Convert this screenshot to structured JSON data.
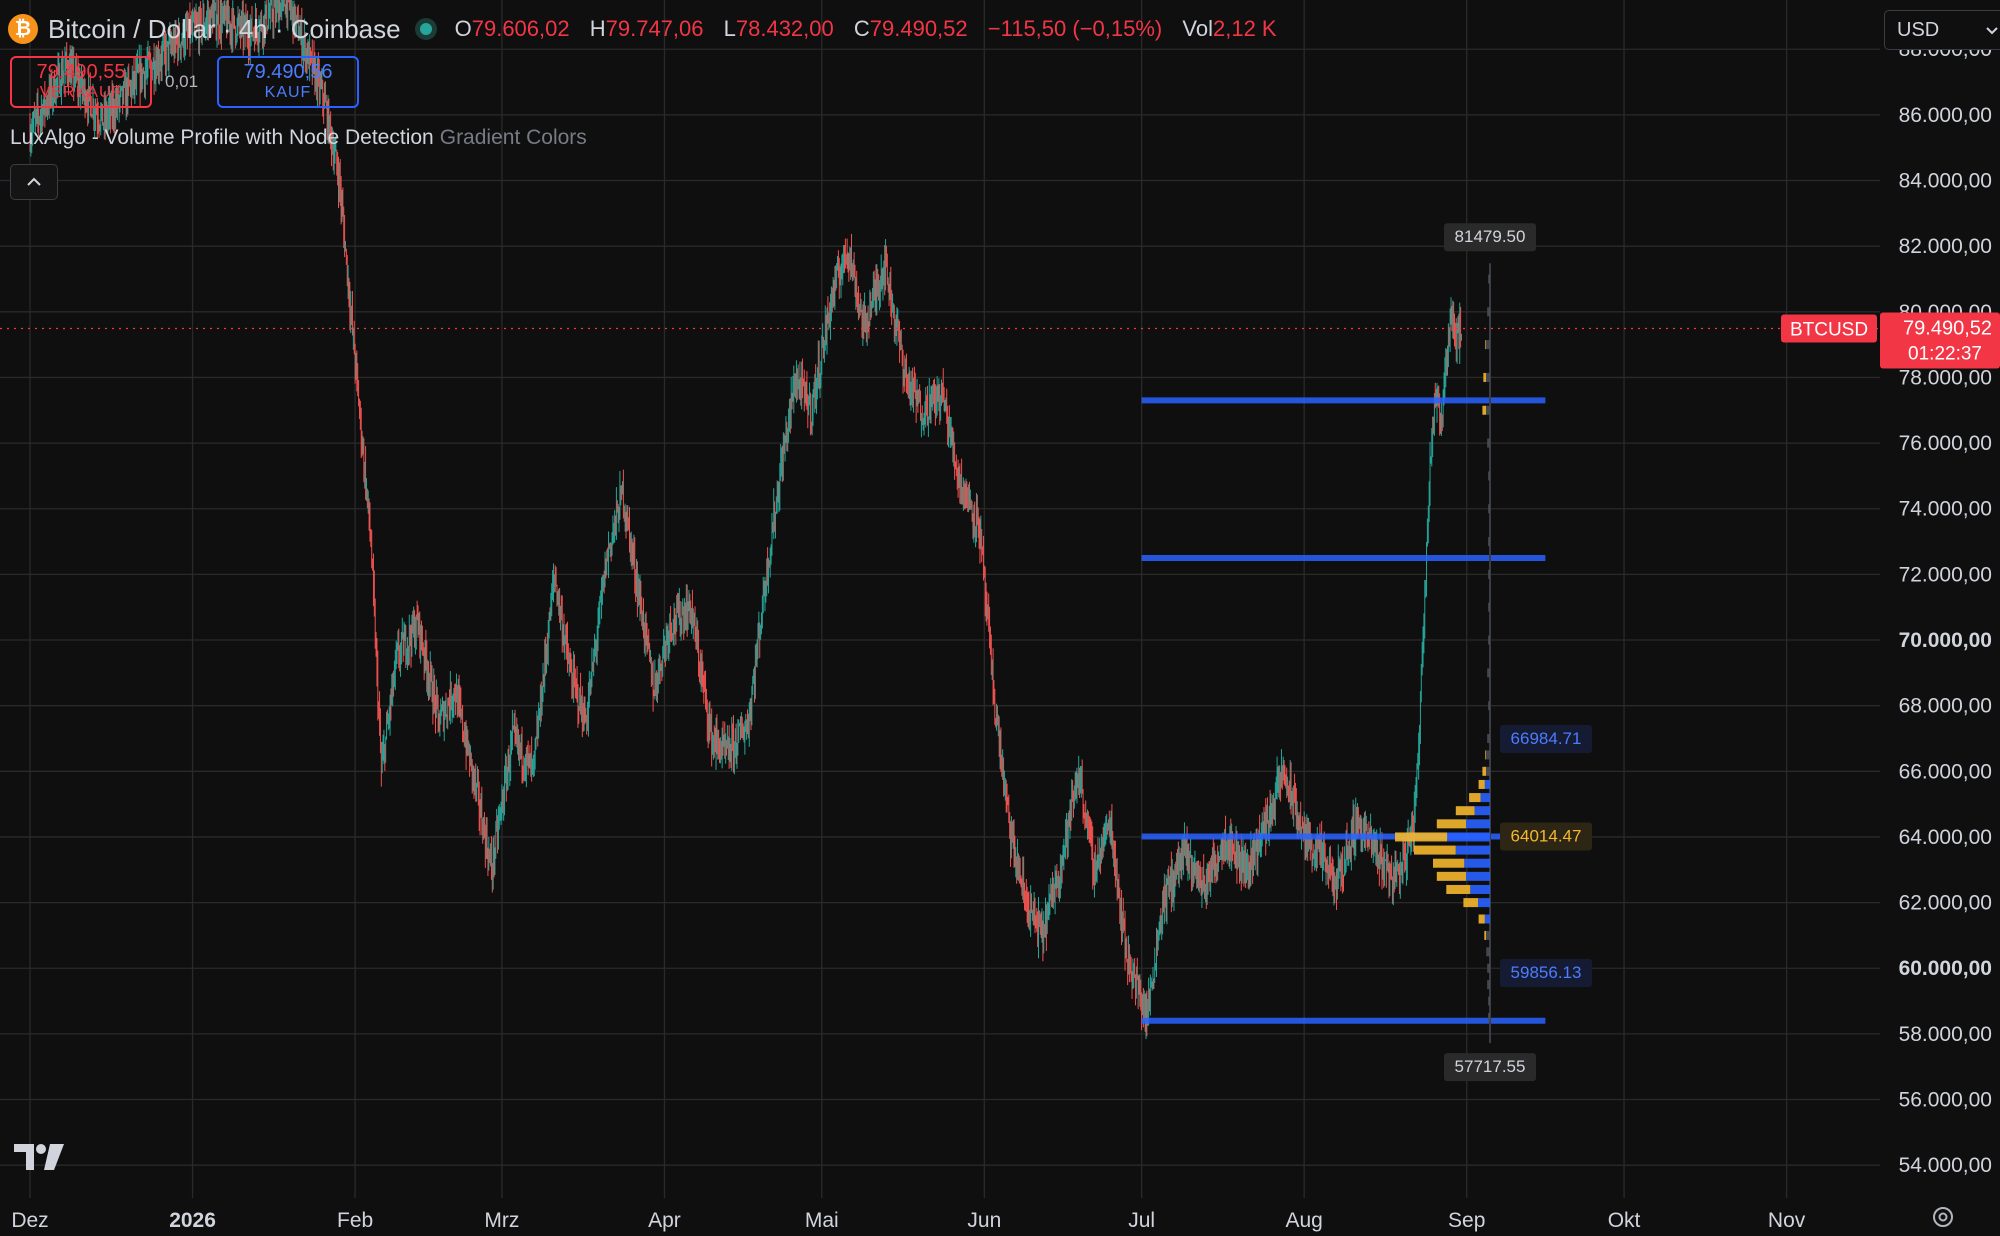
{
  "header": {
    "symbol_title": "Bitcoin / Dollar · 4h · Coinbase",
    "coin_glyph": "₿",
    "open_label": "O",
    "open_value": "79.606,02",
    "high_label": "H",
    "high_value": "79.747,06",
    "low_label": "L",
    "low_value": "78.432,00",
    "close_label": "C",
    "close_value": "79.490,52",
    "change_value": "−115,50 (−0,15%)",
    "vol_label": "Vol",
    "vol_value": "2,12 K",
    "status_color": "#26a69a"
  },
  "trade": {
    "sell_price": "79.490,55",
    "sell_label": "VERKAUF",
    "spread": "0,01",
    "buy_price": "79.490,56",
    "buy_label": "KAUF"
  },
  "indicator": {
    "name": "LuxAlgo - Volume Profile with Node Detection",
    "style": "Gradient Colors",
    "collapse_icon": "chevron-up-icon"
  },
  "currency": {
    "selected": "USD",
    "icon": "chevron-down-icon"
  },
  "colors": {
    "up": "#26a69a",
    "down": "#ef5350",
    "node_line": "#2962ff",
    "profile_blue": "#2962ff",
    "profile_gold": "#f5b82e",
    "price_tag": "#f23645",
    "background": "#0f0f0f",
    "grid": "#2a2a2a"
  },
  "chart_data": {
    "type": "candlestick",
    "symbol": "BTCUSD",
    "interval": "4h",
    "ylim": [
      53000,
      89500
    ],
    "xlim": [
      "2025-12-01",
      "2026-11-15"
    ],
    "grid": true,
    "y_ticks": [
      {
        "value": 88000,
        "label": "88.000,00"
      },
      {
        "value": 86000,
        "label": "86.000,00"
      },
      {
        "value": 84000,
        "label": "84.000,00"
      },
      {
        "value": 82000,
        "label": "82.000,00"
      },
      {
        "value": 80000,
        "label": "80.000,00"
      },
      {
        "value": 78000,
        "label": "78.000,00"
      },
      {
        "value": 76000,
        "label": "76.000,00"
      },
      {
        "value": 74000,
        "label": "74.000,00"
      },
      {
        "value": 72000,
        "label": "72.000,00"
      },
      {
        "value": 70000,
        "label": "70.000,00",
        "bold": true
      },
      {
        "value": 68000,
        "label": "68.000,00"
      },
      {
        "value": 66000,
        "label": "66.000,00"
      },
      {
        "value": 64000,
        "label": "64.000,00"
      },
      {
        "value": 62000,
        "label": "62.000,00"
      },
      {
        "value": 60000,
        "label": "60.000,00",
        "bold": true
      },
      {
        "value": 58000,
        "label": "58.000,00"
      },
      {
        "value": 56000,
        "label": "56.000,00"
      },
      {
        "value": 54000,
        "label": "54.000,00"
      }
    ],
    "x_ticks": [
      {
        "date": "2025-12-01",
        "label": "Dez"
      },
      {
        "date": "2026-01-01",
        "label": "2026",
        "bold": true
      },
      {
        "date": "2026-02-01",
        "label": "Feb"
      },
      {
        "date": "2026-03-01",
        "label": "Mrz"
      },
      {
        "date": "2026-04-01",
        "label": "Apr"
      },
      {
        "date": "2026-05-01",
        "label": "Mai"
      },
      {
        "date": "2026-06-01",
        "label": "Jun"
      },
      {
        "date": "2026-07-01",
        "label": "Jul"
      },
      {
        "date": "2026-08-01",
        "label": "Aug"
      },
      {
        "date": "2026-09-01",
        "label": "Sep"
      },
      {
        "date": "2026-10-01",
        "label": "Okt"
      },
      {
        "date": "2026-11-01",
        "label": "Nov"
      }
    ],
    "price_path": [
      [
        "2025-12-01",
        85500
      ],
      [
        "2025-12-08",
        87500
      ],
      [
        "2025-12-15",
        85800
      ],
      [
        "2025-12-22",
        87200
      ],
      [
        "2025-12-29",
        88200
      ],
      [
        "2026-01-05",
        89000
      ],
      [
        "2026-01-12",
        88500
      ],
      [
        "2026-01-19",
        89500
      ],
      [
        "2026-01-26",
        86500
      ],
      [
        "2026-01-29",
        84000
      ],
      [
        "2026-02-01",
        78500
      ],
      [
        "2026-02-04",
        73000
      ],
      [
        "2026-02-06",
        66000
      ],
      [
        "2026-02-09",
        69500
      ],
      [
        "2026-02-13",
        70500
      ],
      [
        "2026-02-17",
        67500
      ],
      [
        "2026-02-20",
        68500
      ],
      [
        "2026-02-24",
        65500
      ],
      [
        "2026-02-27",
        63000
      ],
      [
        "2026-03-03",
        67000
      ],
      [
        "2026-03-07",
        66000
      ],
      [
        "2026-03-11",
        72000
      ],
      [
        "2026-03-14",
        69000
      ],
      [
        "2026-03-17",
        67500
      ],
      [
        "2026-03-21",
        72500
      ],
      [
        "2026-03-24",
        74500
      ],
      [
        "2026-03-27",
        71500
      ],
      [
        "2026-03-30",
        68500
      ],
      [
        "2026-04-02",
        70500
      ],
      [
        "2026-04-06",
        71000
      ],
      [
        "2026-04-10",
        67000
      ],
      [
        "2026-04-13",
        66500
      ],
      [
        "2026-04-17",
        67500
      ],
      [
        "2026-04-20",
        71500
      ],
      [
        "2026-04-23",
        75000
      ],
      [
        "2026-04-26",
        78000
      ],
      [
        "2026-04-29",
        77000
      ],
      [
        "2026-05-03",
        80500
      ],
      [
        "2026-05-06",
        82000
      ],
      [
        "2026-05-09",
        79500
      ],
      [
        "2026-05-13",
        81500
      ],
      [
        "2026-05-17",
        78000
      ],
      [
        "2026-05-20",
        77000
      ],
      [
        "2026-05-24",
        77500
      ],
      [
        "2026-05-27",
        75000
      ],
      [
        "2026-05-31",
        73500
      ],
      [
        "2026-06-03",
        68000
      ],
      [
        "2026-06-06",
        64000
      ],
      [
        "2026-06-09",
        62000
      ],
      [
        "2026-06-12",
        61000
      ],
      [
        "2026-06-16",
        63500
      ],
      [
        "2026-06-19",
        66000
      ],
      [
        "2026-06-22",
        63000
      ],
      [
        "2026-06-25",
        64500
      ],
      [
        "2026-06-28",
        60500
      ],
      [
        "2026-06-30",
        59500
      ],
      [
        "2026-07-02",
        58500
      ],
      [
        "2026-07-05",
        62000
      ],
      [
        "2026-07-09",
        63500
      ],
      [
        "2026-07-13",
        62500
      ],
      [
        "2026-07-17",
        64000
      ],
      [
        "2026-07-21",
        63000
      ],
      [
        "2026-07-25",
        64500
      ],
      [
        "2026-07-28",
        66000
      ],
      [
        "2026-08-01",
        64000
      ],
      [
        "2026-08-04",
        63500
      ],
      [
        "2026-08-07",
        62500
      ],
      [
        "2026-08-11",
        64500
      ],
      [
        "2026-08-15",
        63500
      ],
      [
        "2026-08-18",
        62800
      ],
      [
        "2026-08-20",
        63200
      ],
      [
        "2026-08-22",
        64500
      ],
      [
        "2026-08-23",
        67500
      ],
      [
        "2026-08-24",
        71500
      ],
      [
        "2026-08-25",
        75500
      ],
      [
        "2026-08-26",
        77500
      ],
      [
        "2026-08-27",
        76500
      ],
      [
        "2026-08-28",
        78500
      ],
      [
        "2026-08-29",
        80000
      ],
      [
        "2026-08-30",
        79200
      ],
      [
        "2026-08-31",
        79490
      ]
    ],
    "current_price": {
      "value": 79490.52,
      "symbol": "BTCUSD",
      "price_label": "79.490,52",
      "countdown": "01:22:37"
    },
    "node_levels": [
      {
        "price": 77300,
        "start": "2026-07-01"
      },
      {
        "price": 72500,
        "start": "2026-07-01"
      },
      {
        "price": 64014.47,
        "start": "2026-07-01"
      },
      {
        "price": 58400,
        "start": "2026-07-01"
      }
    ],
    "profile_labels": [
      {
        "price": 81479.5,
        "label": "81479.50",
        "kind": "range-high"
      },
      {
        "price": 66984.71,
        "label": "66984.71",
        "kind": "value-area-high"
      },
      {
        "price": 64014.47,
        "label": "64014.47",
        "kind": "poc"
      },
      {
        "price": 59856.13,
        "label": "59856.13",
        "kind": "value-area-low"
      },
      {
        "price": 57717.55,
        "label": "57717.55",
        "kind": "range-low"
      }
    ],
    "volume_profile": [
      [
        81000,
        0.02
      ],
      [
        80000,
        0.03
      ],
      [
        79000,
        0.05
      ],
      [
        78000,
        0.07
      ],
      [
        77000,
        0.08
      ],
      [
        76000,
        0.03
      ],
      [
        75000,
        0.02
      ],
      [
        74000,
        0.02
      ],
      [
        73000,
        0.02
      ],
      [
        72000,
        0.02
      ],
      [
        71000,
        0.02
      ],
      [
        70000,
        0.02
      ],
      [
        69000,
        0.03
      ],
      [
        68000,
        0.02
      ],
      [
        67000,
        0.03
      ],
      [
        66500,
        0.05
      ],
      [
        66000,
        0.08
      ],
      [
        65600,
        0.12
      ],
      [
        65200,
        0.22
      ],
      [
        64800,
        0.36
      ],
      [
        64400,
        0.56
      ],
      [
        64000,
        1.0
      ],
      [
        63600,
        0.8
      ],
      [
        63200,
        0.6
      ],
      [
        62800,
        0.56
      ],
      [
        62400,
        0.46
      ],
      [
        62000,
        0.28
      ],
      [
        61500,
        0.12
      ],
      [
        61000,
        0.06
      ],
      [
        60500,
        0.04
      ],
      [
        60000,
        0.03
      ],
      [
        59500,
        0.03
      ],
      [
        59000,
        0.02
      ],
      [
        58500,
        0.02
      ]
    ]
  }
}
